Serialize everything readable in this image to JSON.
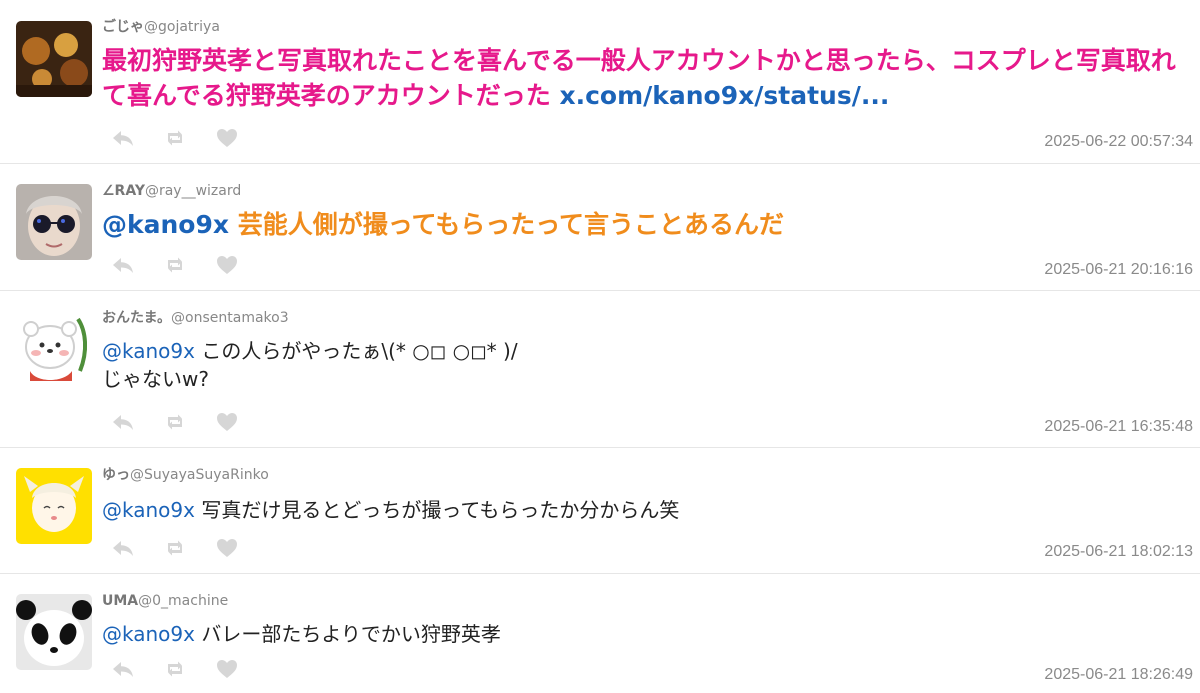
{
  "tweets": [
    {
      "name": "ごじゃ",
      "handle": "@gojatriya",
      "text_parts": [
        {
          "kind": "text",
          "value": "最初狩野英孝と写真取れたことを喜んでる一般人アカウントかと思ったら、コスプレと写真取れて喜んでる狩野英孝のアカウントだった "
        },
        {
          "kind": "link",
          "value": "x.com/kano9x/status/..."
        }
      ],
      "text_color": "#e6198b",
      "big": true,
      "timestamp": "2025-06-22 00:57:34",
      "avatar": "dark-photo-avatar"
    },
    {
      "name": "∠RAY",
      "handle": "@ray__wizard",
      "text_parts": [
        {
          "kind": "mention",
          "value": "@kano9x"
        },
        {
          "kind": "text",
          "value": " 芸能人側が撮ってもらったって言うことあるんだ"
        }
      ],
      "text_color": "#f08c1c",
      "big": true,
      "timestamp": "2025-06-21 20:16:16",
      "avatar": "sunglasses-avatar"
    },
    {
      "name": "おんたま。",
      "handle": "@onsentamako3",
      "text_parts": [
        {
          "kind": "mention",
          "value": "@kano9x"
        },
        {
          "kind": "text",
          "value": " この人らがやったぁ\\(* ○◻︎ ○◻︎* )/"
        },
        {
          "kind": "break",
          "value": ""
        },
        {
          "kind": "text",
          "value": "じゃないw?"
        }
      ],
      "text_color": "#222222",
      "big": false,
      "timestamp": "2025-06-21 16:35:48",
      "avatar": "white-bear-avatar"
    },
    {
      "name": "ゆっ",
      "handle": "@SuyayaSuyaRinko",
      "text_parts": [
        {
          "kind": "mention",
          "value": "@kano9x"
        },
        {
          "kind": "text",
          "value": " 写真だけ見るとどっちが撮ってもらったか分からん笑"
        }
      ],
      "text_color": "#222222",
      "big": false,
      "timestamp": "2025-06-21 18:02:13",
      "avatar": "yellow-character-avatar"
    },
    {
      "name": "UMA",
      "handle": "@0_machine",
      "text_parts": [
        {
          "kind": "mention",
          "value": "@kano9x"
        },
        {
          "kind": "text",
          "value": " バレー部たちよりでかい狩野英孝"
        }
      ],
      "text_color": "#222222",
      "big": false,
      "timestamp": "2025-06-21 18:26:49",
      "avatar": "panda-avatar"
    }
  ],
  "icons": {
    "reply": "reply-icon",
    "retweet": "retweet-icon",
    "like": "heart-icon"
  },
  "colors": {
    "mention": "#1b63b8",
    "meta": "#8a8a8a",
    "action_icon": "#d6d6d6",
    "divider": "#e6e6e6"
  }
}
